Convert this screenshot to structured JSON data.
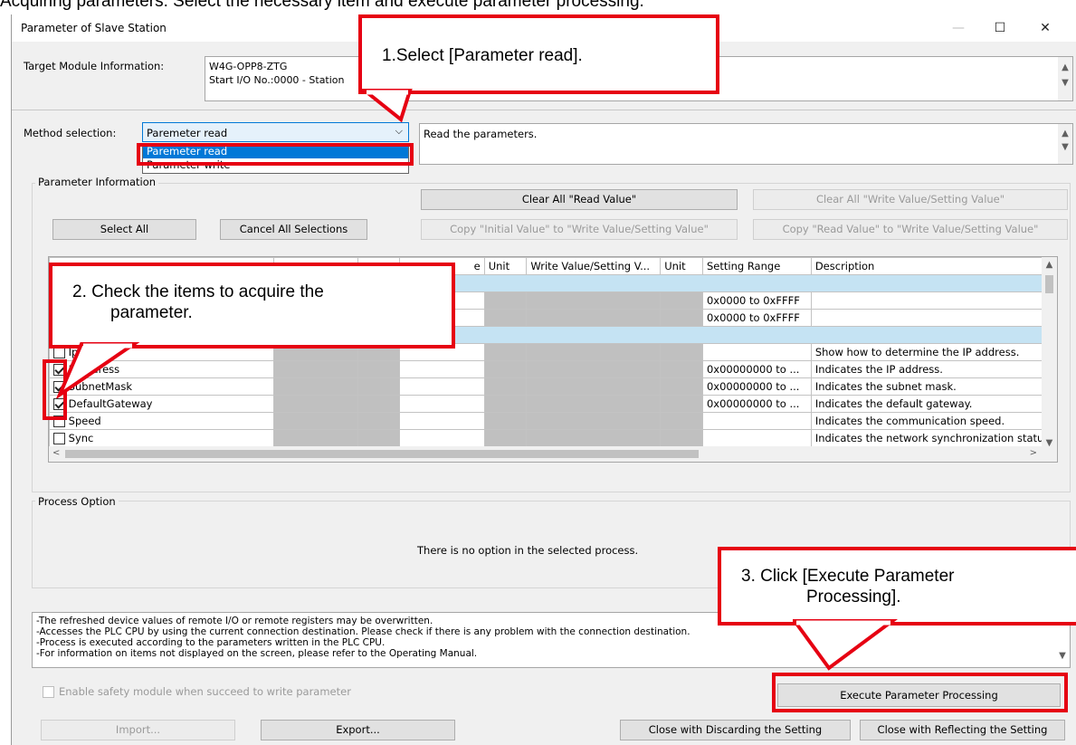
{
  "caption": "Acquiring parameters: Select the necessary item and execute parameter processing.",
  "window": {
    "title": "Parameter of Slave Station",
    "minimize": "—",
    "maximize": "☐",
    "close": "✕"
  },
  "target": {
    "label": "Target Module Information:",
    "line1": "W4G-OPP8-ZTG",
    "line2": "Start I/O No.:0000 - Station"
  },
  "method": {
    "label": "Method selection:",
    "selected": "Paremeter read",
    "options": [
      "Paremeter read",
      "Parameter write"
    ],
    "description": "Read the parameters."
  },
  "param_info": {
    "label": "Parameter Information",
    "clear_read": "Clear All \"Read Value\"",
    "clear_write": "Clear All \"Write Value/Setting Value\"",
    "select_all": "Select All",
    "cancel_all": "Cancel All Selections",
    "copy_initial": "Copy \"Initial Value\" to \"Write Value/Setting Value\"",
    "copy_read": "Copy \"Read Value\" to \"Write Value/Setting Value\""
  },
  "columns": {
    "value": "e",
    "unit": "Unit",
    "write": "Write Value/Setting V...",
    "unit2": "Unit",
    "range": "Setting Range",
    "desc": "Description"
  },
  "rows": [
    {
      "name": "",
      "range": "",
      "desc": "",
      "section": true
    },
    {
      "name": "",
      "range": "0x0000 to 0xFFFF",
      "desc": ""
    },
    {
      "name": "",
      "range": "0x0000 to 0xFFFF",
      "desc": ""
    },
    {
      "name": "",
      "range": "",
      "desc": "",
      "section": true
    },
    {
      "name": "IpM",
      "checked": false,
      "range": "",
      "desc": "Show how to determine the IP address."
    },
    {
      "name": "IpAddress",
      "checked": true,
      "range": "0x00000000 to ...",
      "desc": "Indicates the IP address."
    },
    {
      "name": "SubnetMask",
      "checked": true,
      "range": "0x00000000 to ...",
      "desc": "Indicates the subnet mask."
    },
    {
      "name": "DefaultGateway",
      "checked": true,
      "range": "0x00000000 to ...",
      "desc": "Indicates the default gateway."
    },
    {
      "name": "Speed",
      "checked": false,
      "range": "",
      "desc": "Indicates the communication speed."
    },
    {
      "name": "Sync",
      "checked": false,
      "range": "",
      "desc": "Indicates the network synchronization status."
    }
  ],
  "process": {
    "label": "Process Option",
    "empty": "There is no option in the selected process."
  },
  "notes": [
    "-The refreshed device values of remote I/O or remote registers may be overwritten.",
    "-Accesses the PLC CPU by using the current connection destination. Please check if there is any problem with the connection destination.",
    "-Process is executed according to the parameters written in the PLC CPU.",
    "-For information on items not displayed on the screen, please refer to the Operating Manual."
  ],
  "safety": "Enable safety module when succeed to write parameter",
  "buttons": {
    "execute": "Execute Parameter Processing",
    "import": "Import...",
    "export": "Export...",
    "discard": "Close with Discarding the Setting",
    "reflect": "Close with Reflecting the Setting"
  },
  "callouts": {
    "c1": "1.Select [Parameter read].",
    "c2a": "2. Check the items to acquire the",
    "c2b": "parameter.",
    "c3a": "3. Click [Execute Parameter",
    "c3b": "Processing]."
  },
  "colors": {
    "accent": "#e60012",
    "section": "#c5e3f3",
    "select": "#0078d7"
  }
}
